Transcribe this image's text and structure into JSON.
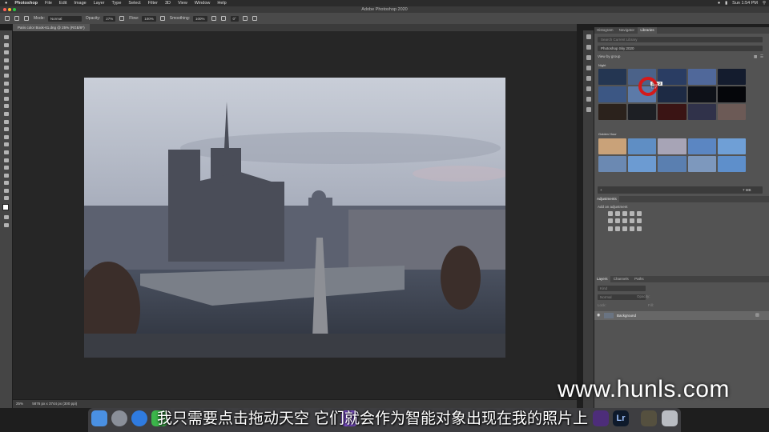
{
  "menubar": {
    "apple": "",
    "items": [
      "Photoshop",
      "File",
      "Edit",
      "Image",
      "Layer",
      "Type",
      "Select",
      "Filter",
      "3D",
      "View",
      "Window",
      "Help"
    ],
    "clock": "Sun 1:54 PM"
  },
  "window": {
    "title": "Adobe Photoshop 2020"
  },
  "options": {
    "mode_label": "Mode:",
    "mode_value": "Normal",
    "opacity_label": "Opacity:",
    "opacity_value": "27%",
    "flow_label": "Flow:",
    "flow_value": "100%",
    "smoothing_label": "Smoothing:",
    "smoothing_value": "100%",
    "angle_value": "0°"
  },
  "document": {
    "tab": "Paris color Book-61.dng @ 25% (RGB/8*)"
  },
  "status": {
    "zoom": "25%",
    "size": "5876 px x 3744 px (300 ppi)"
  },
  "panels": {
    "top_tabs": [
      "Histogram",
      "Navigator",
      "Libraries"
    ],
    "search_placeholder": "Search Current Library",
    "library": "Photoshop Sky 2020",
    "view_by": "View by group",
    "group1": "Night",
    "group2": "Golden Hour",
    "tooltip": "Sky 2",
    "count": "7 MB",
    "adjustments_tab": "Adjustments",
    "add_adjustment": "Add an adjustment",
    "layer_tabs": [
      "Layers",
      "Channels",
      "Paths"
    ],
    "kind": "Kind",
    "blend": "Normal",
    "opacity": "Opacity:",
    "lock": "Lock:",
    "fill": "Fill:",
    "layer_name": "Background"
  },
  "subtitle": "我只需要点击拖动天空 它们就会作为智能对象出现在我的照片上",
  "watermark": "www.hunls.com",
  "colors": {
    "accent_red": "#d41a1a",
    "panel": "#535353",
    "canvas": "#262626"
  }
}
